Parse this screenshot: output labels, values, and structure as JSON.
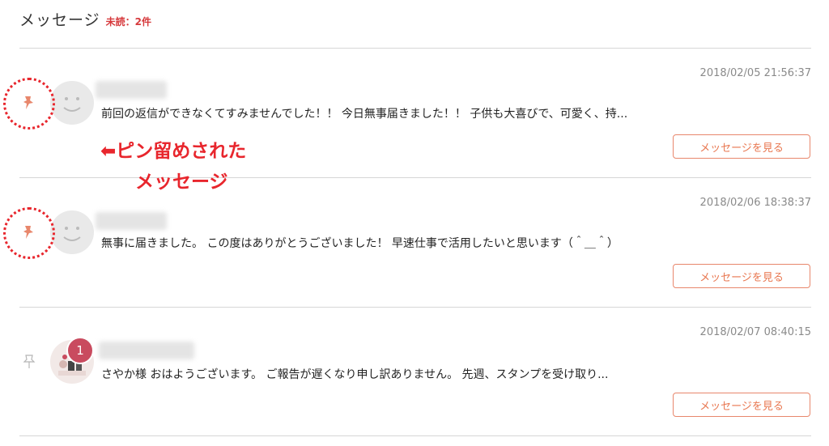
{
  "header": {
    "title": "メッセージ",
    "unread": "未読：2件"
  },
  "messages": [
    {
      "timestamp": "2018/02/05 21:56:37",
      "snippet": "前回の返信ができなくてすみませんでした！！ 今日無事届きました！！ 子供も大喜びで、可愛く、持...",
      "pinned": true,
      "button": "メッセージを見る"
    },
    {
      "timestamp": "2018/02/06 18:38:37",
      "snippet": "無事に届きました。 この度はありがとうございました！ 早速仕事で活用したいと思います（＾＿＾）",
      "pinned": true,
      "button": "メッセージを見る"
    },
    {
      "timestamp": "2018/02/07 08:40:15",
      "snippet": "さやか様 おはようございます。 ご報告が遅くなり申し訳ありません。 先週、スタンプを受け取り...",
      "pinned": false,
      "badge": "1",
      "button": "メッセージを見る"
    }
  ],
  "annotation": {
    "line1": "ピン留めされた",
    "line2": "メッセージ"
  },
  "colors": {
    "accent": "#e8764f",
    "annotation": "#e8262d",
    "badge": "#c94b5f",
    "pin_active": "#e8876c"
  }
}
